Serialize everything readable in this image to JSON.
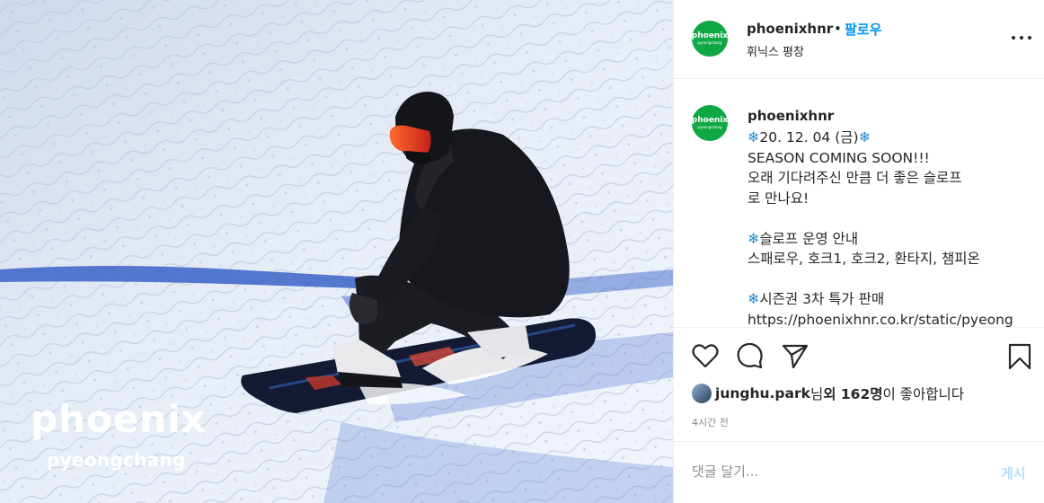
{
  "photo": {
    "brand_word": "phoenix",
    "brand_sub": "pyeongchang"
  },
  "post_header": {
    "avatar_text": "phoenix",
    "avatar_sub": "pyeongchang",
    "username": "phoenixhnr",
    "separator": "•",
    "follow_label": "팔로우",
    "location": "휘닉스 평창"
  },
  "caption": {
    "username": "phoenixhnr",
    "lines": [
      {
        "icon": "❄",
        "text": "20. 12. 04 (금)",
        "icon_after": "❄"
      },
      {
        "icon": "",
        "text": "SEASON COMING SOON!!!",
        "icon_after": ""
      },
      {
        "icon": "",
        "text": "오래 기다려주신 만큼 더 좋은 슬로프",
        "icon_after": ""
      },
      {
        "icon": "",
        "text": "로 만나요!",
        "icon_after": ""
      },
      {
        "icon": "",
        "text": "",
        "icon_after": ""
      },
      {
        "icon": "❄",
        "text": "슬로프 운영 안내",
        "icon_after": ""
      },
      {
        "icon": "",
        "text": "스패로우, 호크1, 호크2, 환타지, 챔피온",
        "icon_after": ""
      },
      {
        "icon": "",
        "text": "",
        "icon_after": ""
      },
      {
        "icon": "❄",
        "text": "시즌권 3차 특가 판매",
        "icon_after": ""
      },
      {
        "icon": "",
        "text": "https://phoenixhnr.co.kr/static/pyeong",
        "icon_after": ""
      }
    ]
  },
  "actions": {
    "icons": [
      "heart-icon",
      "comment-icon",
      "share-icon",
      "bookmark-icon"
    ]
  },
  "likes": {
    "user": "junghu.park",
    "suffix_1": "님 ",
    "bold": "외 162명",
    "suffix_2": "이 좋아합니다"
  },
  "timestamp": "4시간 전",
  "comment": {
    "placeholder": "댓글 달기...",
    "post_label": "게시"
  },
  "colors": {
    "accent": "#0095f6",
    "brand_green": "#0fa844",
    "snowflake": "#1b8fd3"
  }
}
